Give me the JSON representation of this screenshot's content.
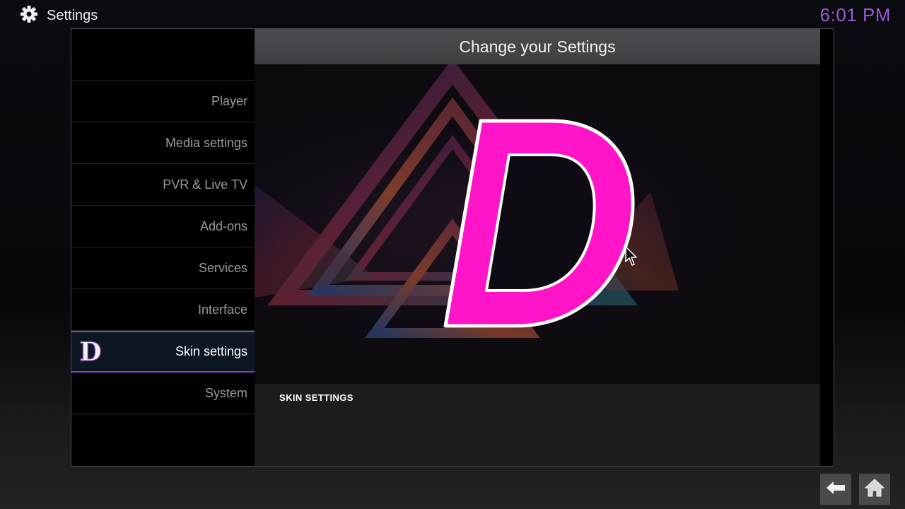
{
  "app": {
    "title": "Settings",
    "time": "6:01 PM",
    "accent": "#9d5bd2"
  },
  "sidebar": {
    "items": [
      {
        "label": "Player"
      },
      {
        "label": "Media settings"
      },
      {
        "label": "PVR & Live TV"
      },
      {
        "label": "Add-ons"
      },
      {
        "label": "Services"
      },
      {
        "label": "Interface"
      },
      {
        "label": "Skin settings",
        "active": true,
        "icon": "skin-d-logo-icon"
      },
      {
        "label": "System"
      }
    ]
  },
  "content": {
    "header": "Change your Settings",
    "logo_letter": "D",
    "logo_color": "#ff14c8",
    "description_title": "SKIN SETTINGS"
  },
  "footer": {
    "back_icon": "back-arrow-icon",
    "home_icon": "home-icon"
  }
}
